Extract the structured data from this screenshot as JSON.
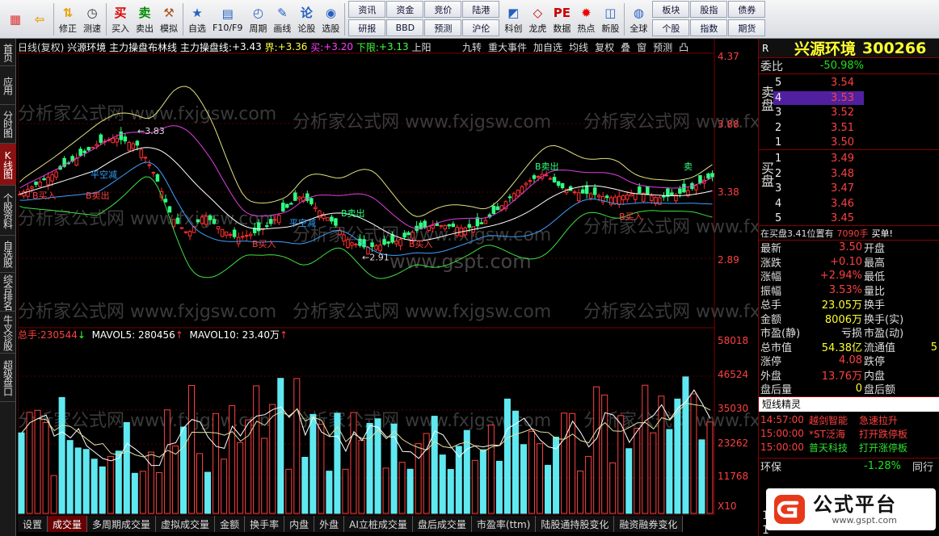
{
  "toolbar": {
    "buttons": [
      {
        "label": "",
        "icon": "grid-icon"
      },
      {
        "label": "",
        "icon": "back-arrow-icon"
      },
      {
        "label": "修正",
        "icon": "arrows-icon"
      },
      {
        "label": "测速",
        "icon": "clock-icon"
      },
      {
        "label": "买入",
        "icon": "buy-icon"
      },
      {
        "label": "卖出",
        "icon": "sell-icon"
      },
      {
        "label": "模拟",
        "icon": "hammer-icon"
      },
      {
        "label": "自选",
        "icon": "star-icon"
      },
      {
        "label": "F10/F9",
        "icon": "f10-icon"
      },
      {
        "label": "周期",
        "icon": "period-icon"
      },
      {
        "label": "画线",
        "icon": "pencil-icon"
      },
      {
        "label": "论股",
        "icon": "discuss-icon"
      },
      {
        "label": "选股",
        "icon": "select-icon"
      }
    ],
    "tabs_left": [
      "资讯",
      "研报",
      "资金",
      "BBD",
      "竞价",
      "预测",
      "陆港",
      "沪伦"
    ],
    "buttons2": [
      {
        "label": "科创",
        "icon": "chart-icon"
      },
      {
        "label": "龙虎",
        "icon": "dragon-icon"
      },
      {
        "label": "数据",
        "icon": "pe-icon"
      },
      {
        "label": "热点",
        "icon": "hot-icon"
      },
      {
        "label": "新股",
        "icon": "ipo-icon"
      },
      {
        "label": "全球",
        "icon": "globe-icon"
      }
    ],
    "tabs_right": [
      "板块",
      "个股",
      "股指",
      "指数",
      "债券",
      "期货"
    ]
  },
  "sidebar": [
    "首页",
    "应用",
    "分时图",
    "K线图",
    "个股资料",
    "自选股",
    "综合排名",
    "牛叉诊股",
    "超级盘口"
  ],
  "chart_info": {
    "period": "日线(复权)",
    "name": "兴源环境",
    "indicator": "主力操盘布林线",
    "line1_label": "主力操盘线:",
    "line1_value": "+3.43",
    "upper_label": "界:",
    "upper_value": "+3.36",
    "buy_label": "买:",
    "buy_value": "+3.20",
    "lower_label": "下限:",
    "lower_value": "+3.13",
    "tail": "上阳"
  },
  "chart_menu": [
    "九转",
    "重大事件",
    "加自选",
    "均线",
    "复权",
    "叠",
    "窗",
    "预测",
    "凸"
  ],
  "price_axis": [
    "4.37",
    "3.88",
    "3.38",
    "2.89"
  ],
  "price_markers": {
    "high": "3.83",
    "low": "2.91"
  },
  "signals": [
    "B买入",
    "B卖出",
    "平空减",
    "B买入",
    "B卖出",
    "B买入",
    "平空减",
    "B卖出",
    "B买入",
    "卖"
  ],
  "volume_info": {
    "total_label": "总手:",
    "total_value": "230544",
    "mavol5_label": "MAVOL5:",
    "mavol5_value": "280456",
    "mavol10_label": "MAVOL10:",
    "mavol10_value": "23.40万"
  },
  "volume_axis": [
    "58018",
    "46524",
    "35030",
    "23262",
    "11768",
    "X10"
  ],
  "watermarks": [
    "分析家公式网 www.fxjgsw.com",
    "www.gspt.com"
  ],
  "bottom_tabs": [
    "设置",
    "成交量",
    "多周期成交量",
    "虚拟成交量",
    "金额",
    "换手率",
    "内盘",
    "外盘",
    "AI立桩成交量",
    "盘后成交量",
    "市盈率(ttm)",
    "陆股通持股变化",
    "融资融券变化"
  ],
  "stock": {
    "name": "兴源环境",
    "code": "300266",
    "r_label": "R"
  },
  "order_book": {
    "ratio_label": "委比",
    "ratio_value": "-50.98%",
    "sell_label": "卖盘",
    "buy_label": "买盘",
    "sell": [
      {
        "level": "5",
        "price": "3.54"
      },
      {
        "level": "4",
        "price": "3.53"
      },
      {
        "level": "3",
        "price": "3.52"
      },
      {
        "level": "2",
        "price": "3.51"
      },
      {
        "level": "1",
        "price": "3.50"
      }
    ],
    "buy": [
      {
        "level": "1",
        "price": "3.49"
      },
      {
        "level": "2",
        "price": "3.48"
      },
      {
        "level": "3",
        "price": "3.47"
      },
      {
        "level": "4",
        "price": "3.46"
      },
      {
        "level": "5",
        "price": "3.45"
      }
    ],
    "note": "在买盘3.41位置有",
    "note_qty": "7090手",
    "note_tag": "买单!"
  },
  "quote": [
    {
      "l": "最新",
      "v": "3.50",
      "r": "开盘",
      "vc": "red"
    },
    {
      "l": "涨跌",
      "v": "+0.10",
      "r": "最高",
      "vc": "red"
    },
    {
      "l": "涨幅",
      "v": "+2.94%",
      "r": "最低",
      "vc": "red"
    },
    {
      "l": "振幅",
      "v": "3.53%",
      "r": "量比",
      "vc": "red"
    },
    {
      "l": "总手",
      "v": "23.05万",
      "r": "换手",
      "vc": "yellow"
    },
    {
      "l": "金额",
      "v": "8006万",
      "r": "换手(实)",
      "vc": "yellow"
    },
    {
      "l": "市盈(静)",
      "v": "亏损",
      "r": "市盈(动)",
      "vc": "white"
    },
    {
      "l": "总市值",
      "v": "54.38亿",
      "r": "流通值",
      "vc": "yellow"
    },
    {
      "l": "涨停",
      "v": "4.08",
      "r": "跌停",
      "vc": "red"
    },
    {
      "l": "外盘",
      "v": "13.76万",
      "r": "内盘",
      "vc": "red"
    },
    {
      "l": "盘后量",
      "v": "0",
      "r": "盘后额",
      "vc": "yellow"
    }
  ],
  "quote_extra": "5",
  "shortline": {
    "title": "短线精灵",
    "items": [
      {
        "time": "14:57:00",
        "name": "越剑智能",
        "event": "急速拉升"
      },
      {
        "time": "15:00:00",
        "name": "*ST泛海",
        "event": "打开跌停板"
      },
      {
        "time": "15:00:00",
        "name": "普天科技",
        "event": "打开涨停板"
      }
    ]
  },
  "sector": {
    "name": "环保",
    "change": "-1.28%",
    "tail": "同行"
  },
  "side_digits": [
    "1",
    "1"
  ],
  "logo": {
    "text": "公式平台",
    "url": "www.gspt.com"
  },
  "colors": {
    "up": "#ff3030",
    "down": "#30ff80",
    "ma": "#ffffff",
    "band_upper": "#e0e080",
    "band_mid": "#e040e0",
    "band_low": "#40e040"
  }
}
